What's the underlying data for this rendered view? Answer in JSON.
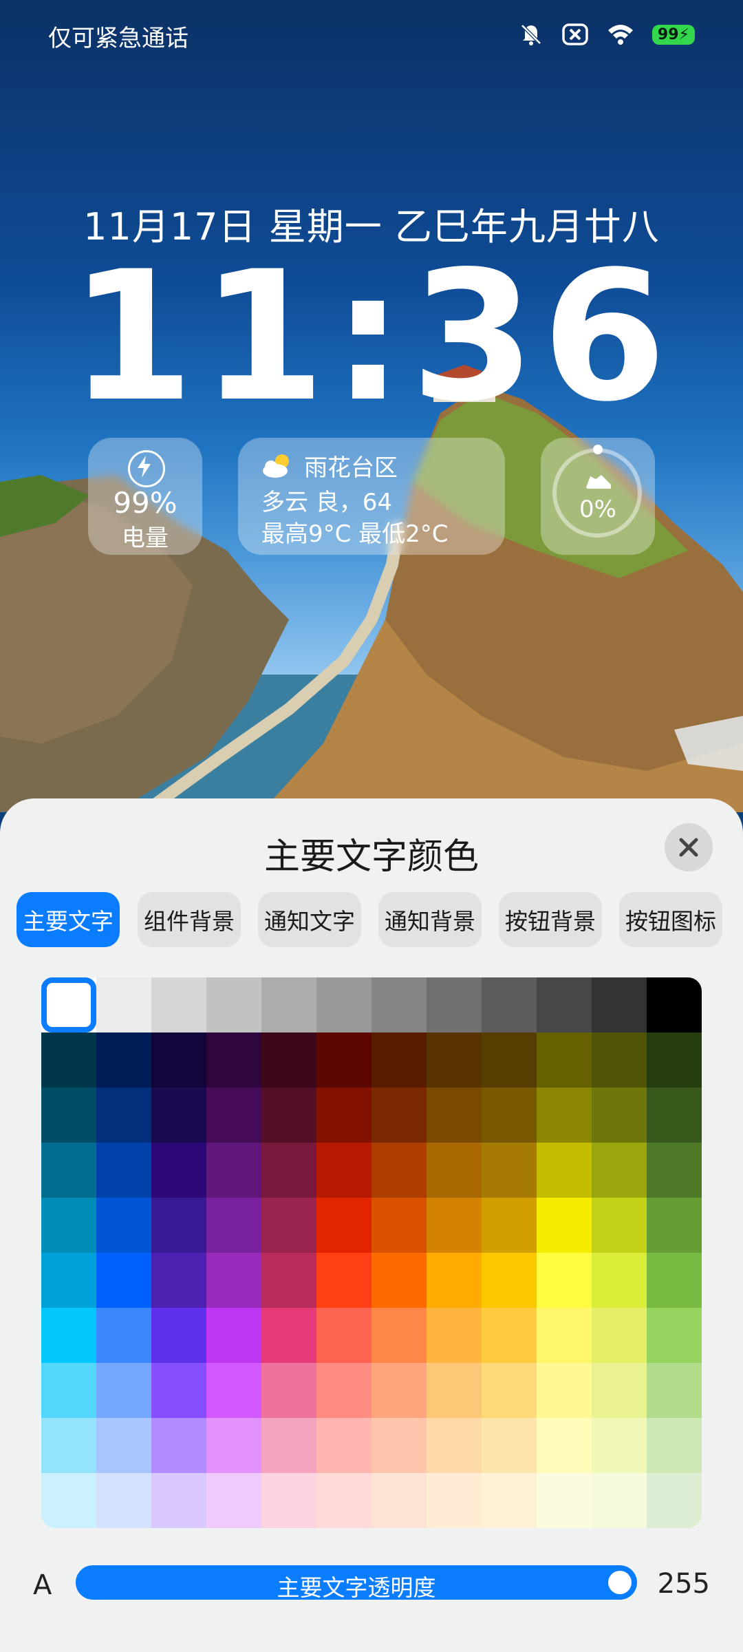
{
  "status_bar": {
    "carrier_text": "仅可紧急通话",
    "battery": "99",
    "icons": [
      "bell-off-icon",
      "close-box-icon",
      "wifi-icon",
      "battery-icon"
    ]
  },
  "lockscreen": {
    "date": "11月17日 星期一 乙巳年九月廿八",
    "time": "11:36"
  },
  "widgets": {
    "battery": {
      "percent": "99%",
      "label": "电量"
    },
    "weather": {
      "location": "雨花台区",
      "condition": "多云 良，64",
      "range": "最高9°C  最低2°C"
    },
    "steps": {
      "percent": "0%"
    }
  },
  "sheet": {
    "title": "主要文字颜色",
    "tabs": [
      {
        "label": "主要文字",
        "active": true
      },
      {
        "label": "组件背景",
        "active": false
      },
      {
        "label": "通知文字",
        "active": false
      },
      {
        "label": "通知背景",
        "active": false
      },
      {
        "label": "按钮背景",
        "active": false
      },
      {
        "label": "按钮图标",
        "active": false
      }
    ],
    "opacity": {
      "prefix": "A",
      "label": "主要文字透明度",
      "value": "255"
    }
  },
  "colors": {
    "accent": "#0a7cff",
    "palette_rows": [
      [
        "#ffffff",
        "#ebebeb",
        "#d6d6d6",
        "#c2c2c2",
        "#adadad",
        "#999999",
        "#858585",
        "#707070",
        "#5c5c5c",
        "#474747",
        "#333333",
        "#000000"
      ],
      [
        "#00374a",
        "#011d57",
        "#11053b",
        "#2e063d",
        "#3c071b",
        "#5c0701",
        "#5a1c00",
        "#583300",
        "#563d00",
        "#666100",
        "#4f5504",
        "#263e0f"
      ],
      [
        "#004d65",
        "#012f7b",
        "#1a0a52",
        "#450d59",
        "#551029",
        "#831100",
        "#7b2900",
        "#7a4a00",
        "#785800",
        "#8c8602",
        "#6f760a",
        "#38571a"
      ],
      [
        "#016e8f",
        "#0042a9",
        "#2c0977",
        "#61187c",
        "#79193d",
        "#b51a00",
        "#ad3e00",
        "#a96800",
        "#a67b01",
        "#c4bc00",
        "#9ba50e",
        "#4e7a27"
      ],
      [
        "#008cb4",
        "#0056d6",
        "#371a94",
        "#7a219e",
        "#99244f",
        "#e22400",
        "#da5100",
        "#d38301",
        "#d19d01",
        "#f5ec00",
        "#c3d117",
        "#669d34"
      ],
      [
        "#00a1d8",
        "#0061fe",
        "#4d22b2",
        "#982abc",
        "#b92d5d",
        "#ff4015",
        "#ff6a00",
        "#ffab01",
        "#fdc700",
        "#fefb41",
        "#d9ec37",
        "#76bb40"
      ],
      [
        "#01c7fc",
        "#3a87fe",
        "#5e30eb",
        "#be38f3",
        "#e63b7a",
        "#fe6250",
        "#fe8648",
        "#feb43f",
        "#fecb3e",
        "#fff76b",
        "#e4ef65",
        "#96d35f"
      ],
      [
        "#52d6fc",
        "#74a7ff",
        "#864ffe",
        "#d357fe",
        "#ee719e",
        "#ff8c82",
        "#fea57d",
        "#fec777",
        "#fed977",
        "#fff994",
        "#eaf28f",
        "#b1dd8b"
      ],
      [
        "#93e3fc",
        "#a7c6ff",
        "#b18cfe",
        "#e292fe",
        "#f4a4c0",
        "#ffb5af",
        "#ffc5ab",
        "#fed9a8",
        "#fde4a8",
        "#fffbb9",
        "#f1f7b7",
        "#cde8b5"
      ],
      [
        "#cbf0ff",
        "#d3e2ff",
        "#d9c9fe",
        "#efcaff",
        "#f9d3e0",
        "#ffdad8",
        "#ffe2d6",
        "#feecd4",
        "#fef1d5",
        "#fdfbdd",
        "#f6fadb",
        "#deeed4"
      ]
    ]
  }
}
